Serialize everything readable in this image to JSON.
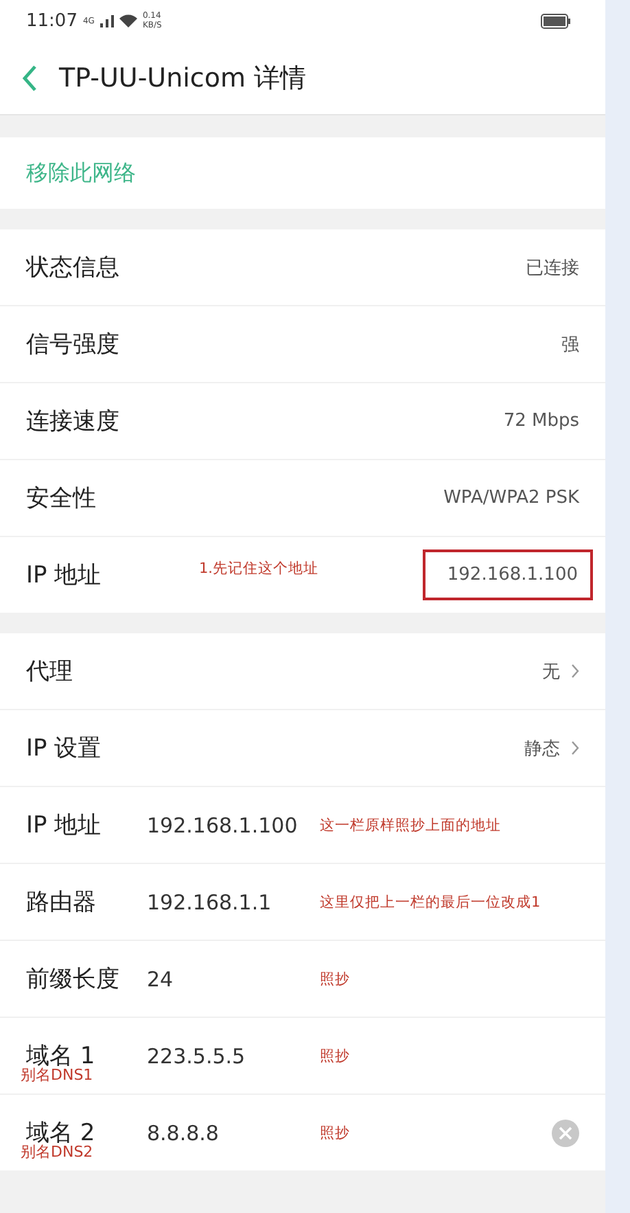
{
  "status_bar": {
    "time": "11:07",
    "network": "4G",
    "speed": [
      "0.14",
      "KB/S"
    ]
  },
  "header": {
    "title": "TP-UU-Unicom 详情"
  },
  "remove_network": "移除此网络",
  "info_rows": [
    {
      "label": "状态信息",
      "value": "已连接",
      "highlighted": false
    },
    {
      "label": "信号强度",
      "value": "强",
      "highlighted": false
    },
    {
      "label": "连接速度",
      "value": "72 Mbps",
      "highlighted": false
    },
    {
      "label": "安全性",
      "value": "WPA/WPA2 PSK",
      "highlighted": false
    },
    {
      "label": "IP 地址",
      "value": "192.168.1.100",
      "note": "1.先记住这个地址",
      "highlighted": true
    }
  ],
  "settings_rows": [
    {
      "kind": "select",
      "label": "代理",
      "value": "无"
    },
    {
      "kind": "select",
      "label": "IP 设置",
      "value": "静态"
    },
    {
      "kind": "field",
      "label": "IP 地址",
      "value": "192.168.1.100",
      "note": "这一栏原样照抄上面的地址"
    },
    {
      "kind": "field",
      "label": "路由器",
      "value": "192.168.1.1",
      "note": "这里仅把上一栏的最后一位改成1"
    },
    {
      "kind": "field",
      "label": "前缀长度",
      "value": "24",
      "note": "照抄"
    },
    {
      "kind": "field",
      "label": "域名 1",
      "value": "223.5.5.5",
      "note": "照抄",
      "alias": "别名DNS1"
    },
    {
      "kind": "field",
      "label": "域名 2",
      "value": "8.8.8.8",
      "note": "照抄",
      "alias": "别名DNS2",
      "clear": true
    }
  ]
}
